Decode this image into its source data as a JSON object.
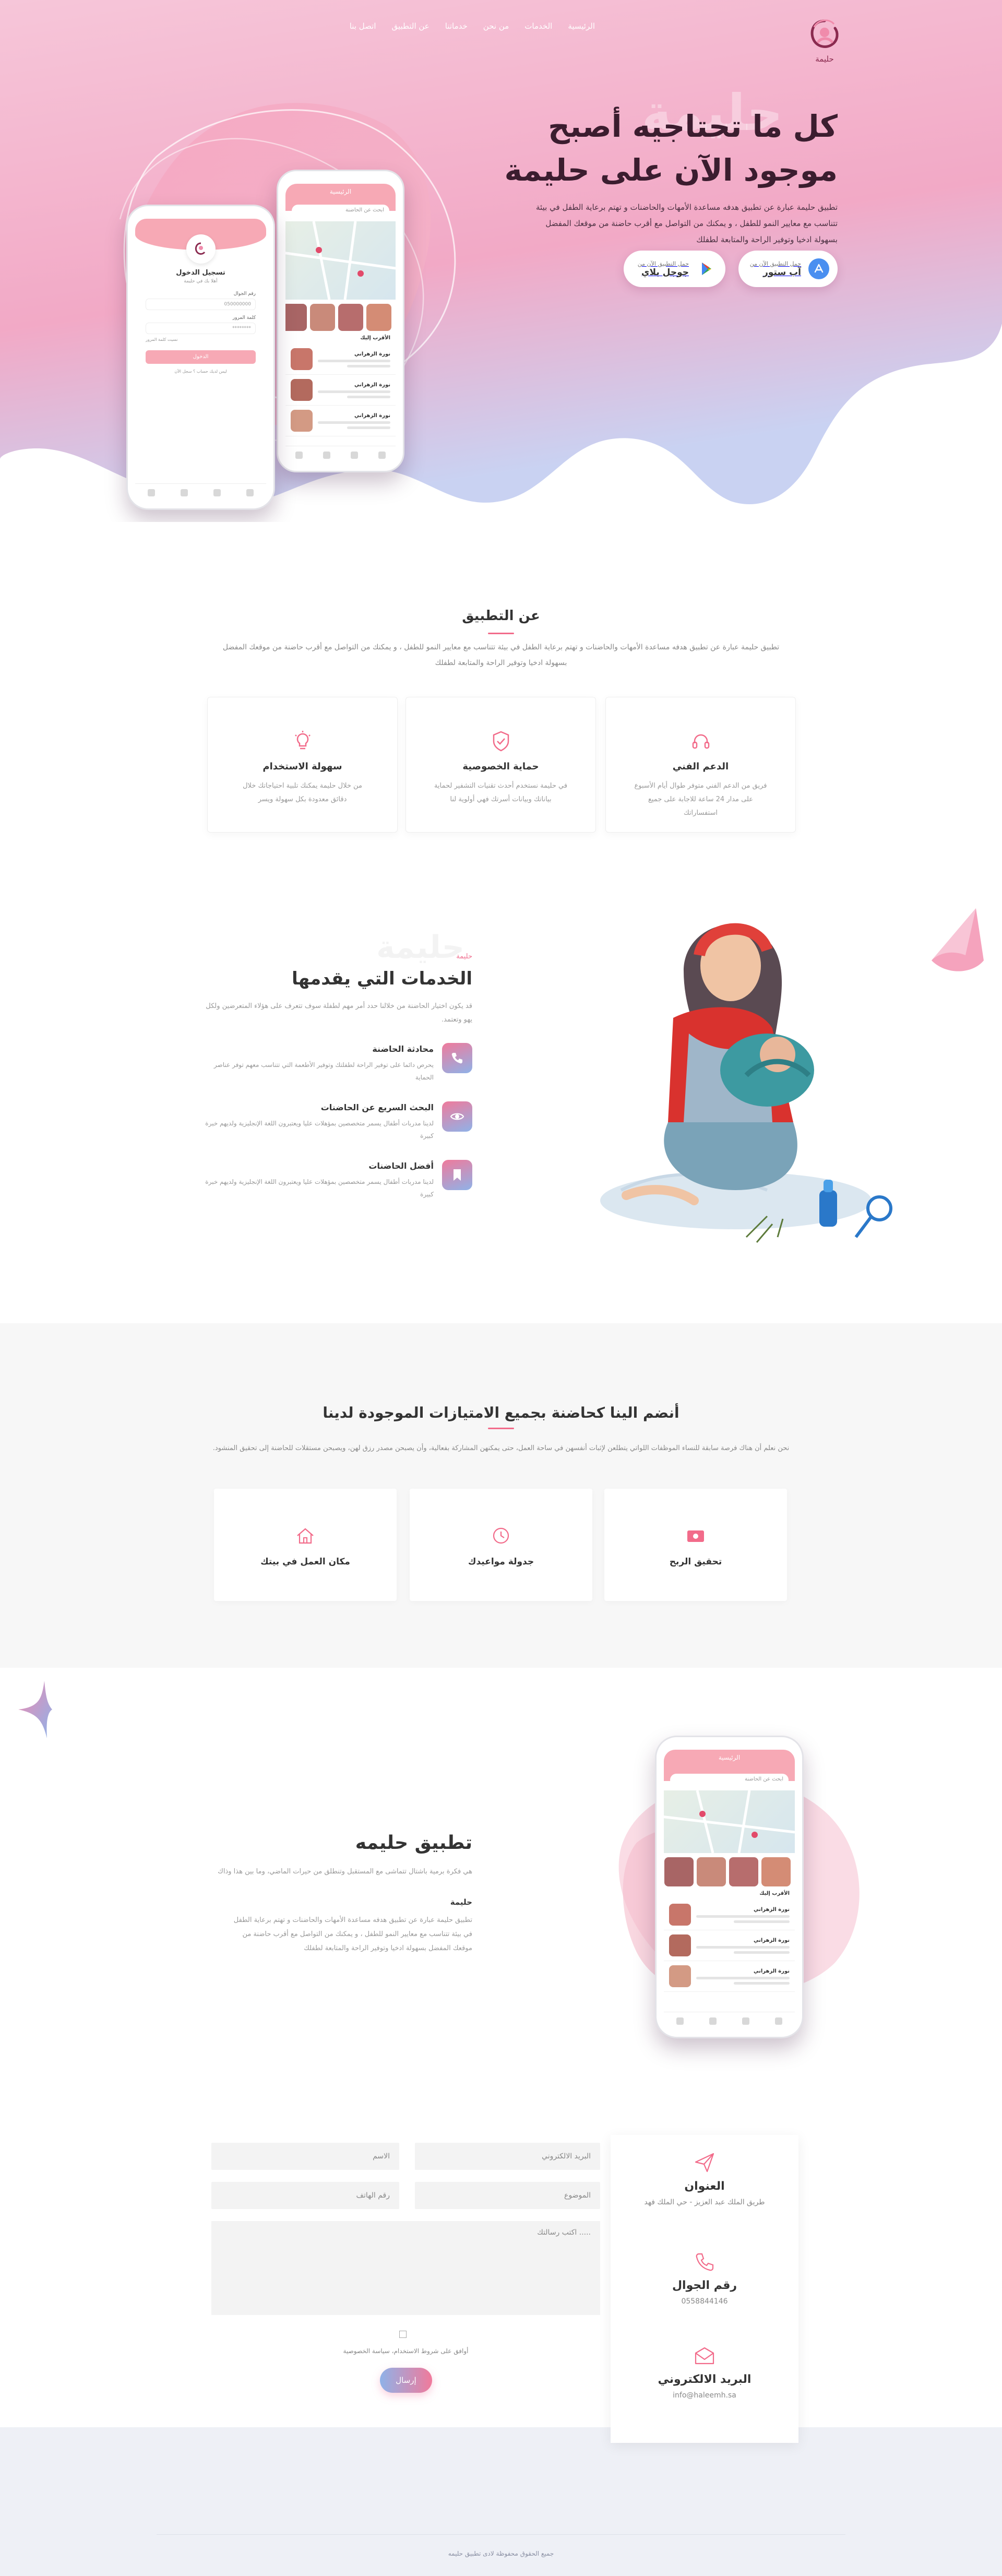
{
  "brand": {
    "name": "حليمة",
    "accent": "#f26b8a",
    "hero_gradient": [
      "#f7c3d6",
      "#f2a4c2",
      "#c8d4f2"
    ]
  },
  "nav": {
    "items": [
      "الرئيسية",
      "الخدمات",
      "من نحن",
      "خدماتنا",
      "عن التطبيق",
      "اتصل بنا"
    ]
  },
  "hero": {
    "ghost": "حليمة",
    "title_line1": "كل ما تحتاجيه أصبح",
    "title_line2": "موجود الآن على حليمة",
    "description": "تطبيق حليمة عبارة عن تطبيق هدفه مساعدة الأمهات والحاضنات و تهتم برعاية الطفل في بيئة تتناسب مع معايير النمو للطفل ، و يمكنك من التواصل مع أقرب حاضنة من موقعك المفضل بسهولة ادخيا وتوفير الراحة والمتابعة لطفلك",
    "app_store": {
      "small": "حمل التطبيق الآن من",
      "big": "آب ستور",
      "icon": "app-store-icon"
    },
    "google_play": {
      "small": "حمل التطبيق الآن من",
      "big": "جوجل بلاي",
      "icon": "google-play-icon"
    }
  },
  "phone_login": {
    "status": "9:41",
    "title": "تسجيل الدخول",
    "subtitle": "أهلا بك في حليمة",
    "phone_label": "رقم الجوال",
    "phone_value": "050000000",
    "password_label": "كلمة المرور",
    "password_value": "********",
    "forgot": "نسيت كلمة المرور",
    "button": "الدخول",
    "register": "ليس لديك حساب ؟ سجل الآن"
  },
  "phone_list": {
    "status": "9:41",
    "title": "الرئيسية",
    "search_placeholder": "ابحث عن الحاضنة",
    "section": "الأقرب إليك",
    "card_name": "نورة الزهراني",
    "card_sub": "حاضنة الأطفال"
  },
  "about": {
    "title": "عن التطبيق",
    "description": "تطبيق حليمة عبارة عن تطبيق هدفه مساعدة الأمهات والحاضنات و تهتم برعاية الطفل في بيئة تتناسب مع معايير النمو للطفل ، و يمكنك من التواصل مع أقرب حاضنة من موقعك المفضل بسهولة ادخيا وتوفير الراحة والمتابعة لطفلك",
    "features": [
      {
        "title": "الدعم الفني",
        "text": "فريق من الدعم الفني متوفر طوال أيام الأسبوع على مدار 24 ساعة للاجابة على جميع استفساراتك",
        "icon": "headset-icon"
      },
      {
        "title": "حماية الخصوصية",
        "text": "في حليمة نستخدم أحدث تقنيات التشفير لحماية بياناتك وبيانات أسرتك فهي أولوية لنا",
        "icon": "shield-check-icon"
      },
      {
        "title": "سهولة الاستخدام",
        "text": "من خلال حليمة يمكنك تلبية احتياجاتك خلال دقائق معدودة بكل سهولة ويسر",
        "icon": "lightbulb-icon"
      }
    ]
  },
  "services": {
    "label": "حليمة",
    "ghost": "حليمة",
    "title": "الخدمات التي يقدمها",
    "description": "قد يكون اختيار الحاضنة من خلالنا حدد أمر مهم لطفلة سوف تتعرف على هؤلاء المتعرضين ولكل يهو وتعتمد.",
    "items": [
      {
        "title": "محادثة الحاضنة",
        "text": "يحرص دائما على توفير الراحة لطفلتك وتوفير الأطعمة التي تتناسب معهم توفر عناصر الحماية",
        "icon": "phone-icon"
      },
      {
        "title": "البحث السريع عن الحاضنات",
        "text": "لدينا مدربات أطفال يسمر متخصصين بمؤهلات عليا ويعتبرون اللغة الإنجليزية ولديهم خبرة كبيرة",
        "icon": "eye-icon"
      },
      {
        "title": "أفضل الحاضنات",
        "text": "لدينا مدربات أطفال يسمر متخصصين بمؤهلات عليا ويعتبرون اللغة الإنجليزية ولديهم خبرة كبيرة",
        "icon": "bookmark-icon"
      }
    ]
  },
  "join": {
    "title": "أنضم الينا كحاضنة بجميع الامتيازات الموجودة لدينا",
    "description": "نحن نعلم أن هناك فرصة سابقة للنساء الموظفات اللواتي يتطلعن لإثبات أنفسهن في ساحة العمل، حتى يمكنهن المشاركة بفعالية، وأن يصبحن مصدر رزق لهن، ويصبحن مستقلات للحاضنة إلى تحقيق المنشود.",
    "cards": [
      {
        "title": "تحقيق الربح",
        "icon": "money-icon"
      },
      {
        "title": "جدولة مواعيدك",
        "icon": "clock-icon"
      },
      {
        "title": "مكان العمل في بيتك",
        "icon": "home-icon"
      }
    ]
  },
  "app": {
    "title": "تطبيق حليمه",
    "description": "هي فكرة برمية باشتال تتماشى مع المستقبل وتنطلق من حيرات الماضي، وما بين هذا وذاك",
    "subtitle": "حليمة",
    "text": "تطبيق حليمة عبارة عن تطبيق هدفه مساعدة الأمهات والحاضنات و تهتم برعاية الطفل في بيئة تتناسب مع معايير النمو للطفل ، و يمكنك من التواصل مع أقرب حاضنة من موقعك المفضل بسهولة ادخيا وتوفير الراحة والمتابعة لطفلك"
  },
  "contact": {
    "address_title": "العنوان",
    "address": "طريق الملك عبد العزيز - حي الملك فهد",
    "phone_title": "رقم الجوال",
    "phone": "0558844146",
    "email_title": "البريد الالكتروني",
    "email": "info@haleemh.sa",
    "form": {
      "email_ph": "البريد الالكتروني",
      "name_ph": "الاسم",
      "subject_ph": "الموضوع",
      "phone_ph": "رقم الهاتف",
      "message_ph": "..... اكتب رسالتك",
      "agree": "أوافق على شروط الاستخدام، سياسة الخصوصية",
      "send": "إرسال"
    }
  },
  "footer": {
    "text": "جميع الحقوق محفوظة لادى تطبيق حليمه"
  }
}
